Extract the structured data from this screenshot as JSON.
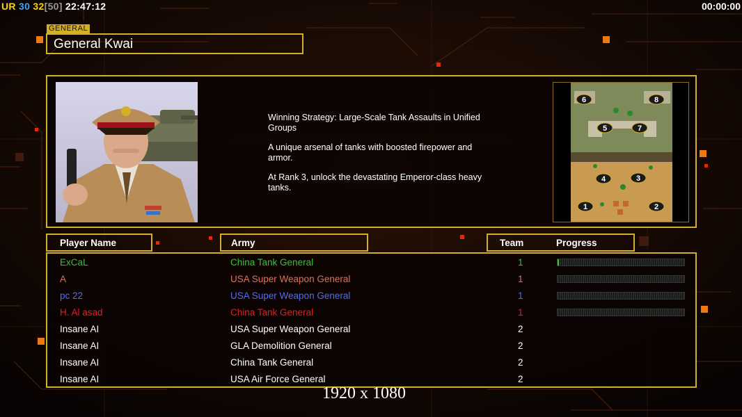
{
  "hud": {
    "ur_label": "UR",
    "fps": "30",
    "fps_cap_value": "32",
    "fps_cap_max": "[50]",
    "clock": "22:47:12",
    "timer": "00:00:00"
  },
  "general": {
    "tag": "GENERAL",
    "name": "General Kwai"
  },
  "description": [
    "Winning Strategy: Large-Scale Tank Assaults in Unified Groups",
    "A unique arsenal of tanks with boosted firepower and armor.",
    "At Rank 3, unlock the devastating Emperor-class heavy tanks."
  ],
  "map": {
    "spawns": [
      "6",
      "8",
      "5",
      "7",
      "4",
      "3",
      "1",
      "2"
    ]
  },
  "table": {
    "headers": {
      "player": "Player Name",
      "army": "Army",
      "team": "Team",
      "progress": "Progress"
    },
    "rows": [
      {
        "player": "ExCaL",
        "army": "China Tank General",
        "team": "1",
        "color": "#38c238",
        "progress": 0.01
      },
      {
        "player": "A",
        "army": "USA Super Weapon General",
        "team": "1",
        "color": "#e0705a",
        "progress": 0
      },
      {
        "player": "pc 22",
        "army": "USA Super Weapon General",
        "team": "1",
        "color": "#4f6cf0",
        "progress": 0
      },
      {
        "player": "H. Al asad",
        "army": "China Tank General",
        "team": "1",
        "color": "#e02020",
        "progress": 0
      },
      {
        "player": "Insane AI",
        "army": "USA Super Weapon General",
        "team": "2",
        "color": "#ffffff",
        "progress": null
      },
      {
        "player": "Insane AI",
        "army": "GLA Demolition General",
        "team": "2",
        "color": "#ffffff",
        "progress": null
      },
      {
        "player": "Insane AI",
        "army": "China Tank General",
        "team": "2",
        "color": "#ffffff",
        "progress": null
      },
      {
        "player": "Insane AI",
        "army": "USA Air Force General",
        "team": "2",
        "color": "#ffffff",
        "progress": null
      }
    ]
  },
  "watermark": "1920 x 1080",
  "colors": {
    "frame": "#d4b02a",
    "accent": "#f07810"
  }
}
